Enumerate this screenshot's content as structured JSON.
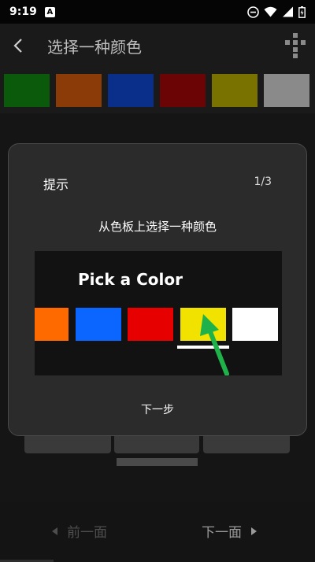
{
  "status_bar": {
    "time": "9:19",
    "notification_letter": "A"
  },
  "app_bar": {
    "title": "选择一种颜色"
  },
  "color_strip": {
    "swatches": [
      "#0b5a0b",
      "#8a3b08",
      "#0a2f8a",
      "#6b0505",
      "#7a7200",
      "#8a8a8a"
    ]
  },
  "dialog": {
    "title": "提示",
    "page_indicator": "1/3",
    "subtitle": "从色板上选择一种颜色",
    "illustration": {
      "heading": "Pick a Color",
      "swatches": [
        "#ff6a00",
        "#0a66ff",
        "#e60000",
        "#f2e200",
        "#ffffff"
      ],
      "arrow_color": "#1fb24a"
    },
    "next_label": "下一步"
  },
  "bottom_bar": {
    "prev_label": "前一面",
    "next_label": "下一面"
  }
}
